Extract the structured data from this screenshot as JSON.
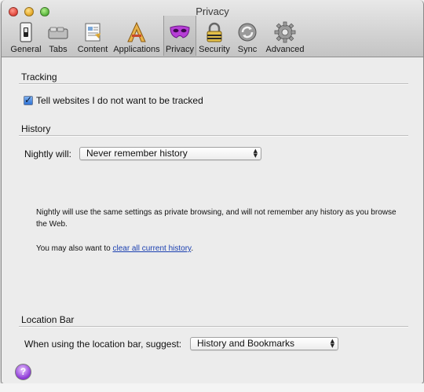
{
  "window": {
    "title": "Privacy"
  },
  "toolbar": {
    "tabs": [
      {
        "label": "General",
        "icon": "general-switch-icon"
      },
      {
        "label": "Tabs",
        "icon": "tabs-icon"
      },
      {
        "label": "Content",
        "icon": "content-icon"
      },
      {
        "label": "Applications",
        "icon": "applications-icon"
      },
      {
        "label": "Privacy",
        "icon": "privacy-mask-icon",
        "active": true
      },
      {
        "label": "Security",
        "icon": "lock-icon"
      },
      {
        "label": "Sync",
        "icon": "sync-icon"
      },
      {
        "label": "Advanced",
        "icon": "gear-icon"
      }
    ]
  },
  "tracking": {
    "heading": "Tracking",
    "do_not_track_label": "Tell websites I do not want to be tracked",
    "do_not_track_checked": true
  },
  "history": {
    "heading": "History",
    "nightly_will_label": "Nightly will:",
    "nightly_will_value": "Never remember history",
    "info_text": "Nightly will use the same settings as private browsing, and will not remember any history as you browse the Web.",
    "clear_prefix": "You may also want to ",
    "clear_link": "clear all current history",
    "clear_suffix": "."
  },
  "location_bar": {
    "heading": "Location Bar",
    "suggest_label": "When using the location bar, suggest:",
    "suggest_value": "History and Bookmarks"
  },
  "help": {
    "glyph": "?"
  },
  "colors": {
    "link": "#1a3fb0",
    "checkbox": "#2f73d6",
    "help": "#8b36d6"
  }
}
